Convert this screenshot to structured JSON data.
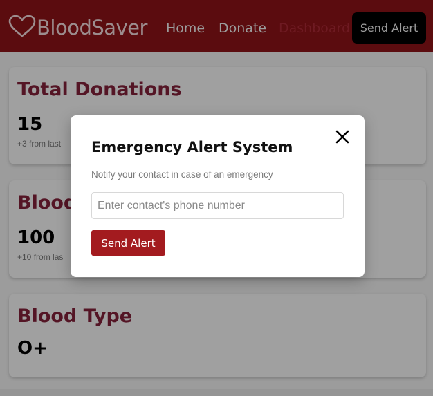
{
  "navbar": {
    "brand_icon": "heart-outline-icon",
    "brand_text": "BloodSaver",
    "links": {
      "home": "Home",
      "donate": "Donate",
      "dashboard": "Dashboard"
    },
    "alert_button": "Send Alert"
  },
  "cards": {
    "total_donations": {
      "title": "Total Donations",
      "value": "15",
      "sub": "+3 from last"
    },
    "blood": {
      "title": "Blood",
      "value": "100",
      "sub": "+10 from las"
    },
    "blood_type": {
      "title": "Blood Type",
      "value": "O+"
    }
  },
  "modal": {
    "title": "Emergency Alert System",
    "close_icon": "close-icon",
    "description": "Notify your contact in case of an emergency",
    "input": {
      "placeholder": "Enter contact's phone number",
      "value": ""
    },
    "submit_label": "Send Alert"
  },
  "colors": {
    "navbar_bg": "#5b0c0f",
    "accent_red": "#a31b1f",
    "card_title": "#541525",
    "overlay_bg": "#9c9c9c"
  }
}
